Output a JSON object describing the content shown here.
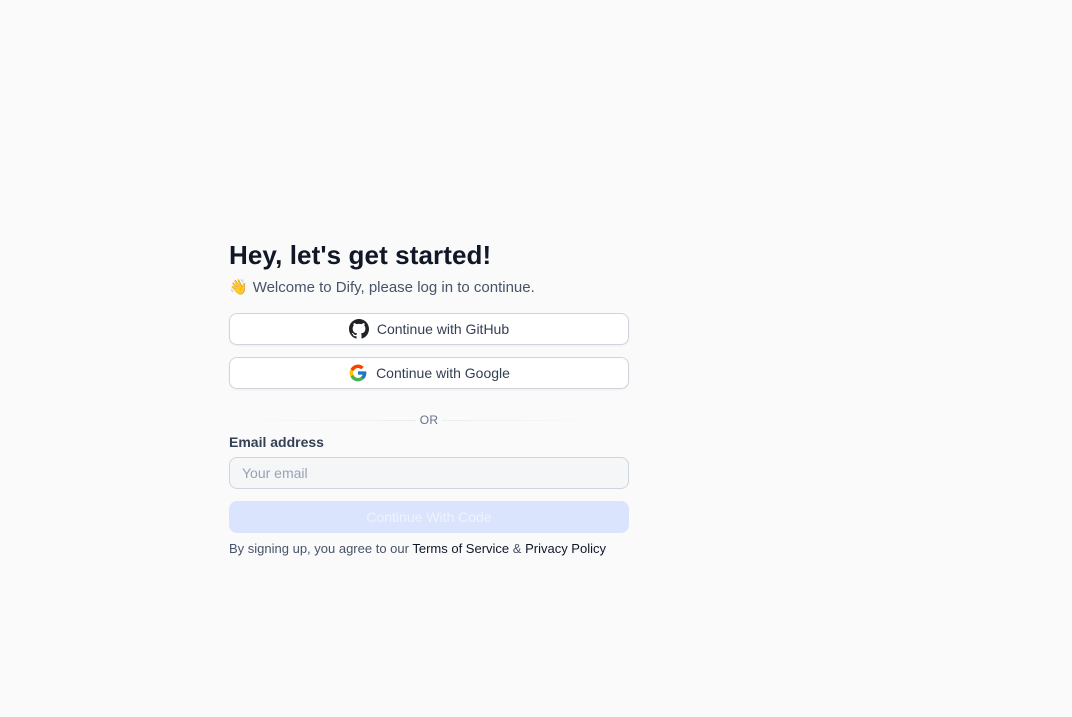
{
  "heading": {
    "title": "Hey, let's get started!",
    "subtitle_emoji": "👋",
    "subtitle": "Welcome to Dify, please log in to continue."
  },
  "oauth": {
    "github_label": "Continue with GitHub",
    "github_icon": "github-icon",
    "google_label": "Continue with Google",
    "google_icon": "google-icon"
  },
  "divider": {
    "label": "OR"
  },
  "email": {
    "label": "Email address",
    "placeholder": "Your email",
    "value": ""
  },
  "submit": {
    "label": "Continue With Code",
    "disabled": true
  },
  "agreement": {
    "prefix": "By signing up, you agree to our",
    "terms": "Terms of Service",
    "separator": "&",
    "privacy": "Privacy Policy"
  },
  "colors": {
    "background": "#fafafa",
    "primary_disabled": "#dbe4fd",
    "text_primary": "#101828",
    "text_secondary": "#475467"
  }
}
